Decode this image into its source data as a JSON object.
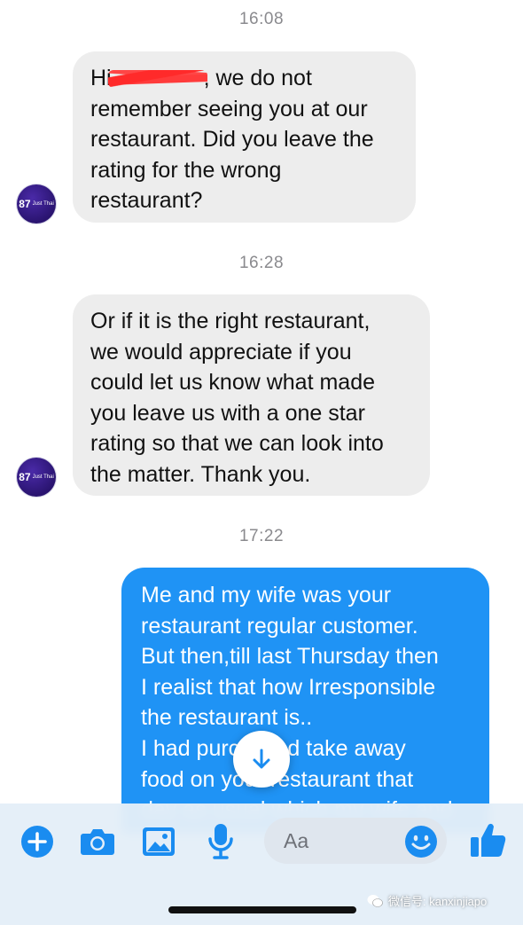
{
  "conversation": {
    "messages": [
      {
        "timestamp": "16:08",
        "sender": "restaurant",
        "lines": [
          "Hi",
          ", we do not",
          "remember seeing you at our",
          "restaurant. Did you leave the",
          "rating for the wrong",
          "restaurant?"
        ]
      },
      {
        "timestamp": "16:28",
        "sender": "restaurant",
        "lines": [
          "Or if it is the right restaurant,",
          "we would appreciate if you",
          "could let us know what made",
          "you leave us with a one star",
          "rating so that we can look into",
          "the matter. Thank you."
        ]
      },
      {
        "timestamp": "17:22",
        "sender": "me",
        "lines": [
          "Me and my wife was your",
          "restaurant regular customer.",
          "But then,till last Thursday then",
          "I realist that how Irresponsible",
          "the restaurant is..",
          "I had purchased take away",
          "food on your restaurant that",
          "day as usual which my wife and"
        ]
      }
    ],
    "avatar": {
      "number": "87",
      "caption": "Just Thai"
    }
  },
  "composer": {
    "placeholder": "Aa",
    "icons": [
      "plus-icon",
      "camera-icon",
      "image-icon",
      "microphone-icon",
      "emoji-icon",
      "thumbs-up-icon"
    ]
  },
  "watermark": {
    "text": "微信号: kanxinjiapo"
  },
  "colors": {
    "incoming_bubble": "#ededed",
    "outgoing_bubble": "#1f93f5",
    "accent": "#1a8cf0",
    "timestamp": "#8a8a8e"
  }
}
